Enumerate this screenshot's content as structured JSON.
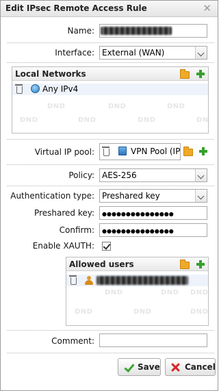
{
  "dialog": {
    "title": "Edit IPsec Remote Access Rule",
    "close_glyph": "✕"
  },
  "form": {
    "name_label": "Name:",
    "interface_label": "Interface:",
    "interface_value": "External (WAN)",
    "local_networks": {
      "header": "Local Networks",
      "items": [
        {
          "icon": "globe-icon",
          "label": "Any IPv4"
        }
      ],
      "watermark": "DND"
    },
    "virtual_ip_pool_label": "Virtual IP pool:",
    "virtual_ip_pool_value": "VPN Pool (IPs",
    "policy_label": "Policy:",
    "policy_value": "AES-256",
    "auth_type_label": "Authentication type:",
    "auth_type_value": "Preshared key",
    "preshared_key_label": "Preshared key:",
    "preshared_key_value": "●●●●●●●●●●●●●●●",
    "confirm_label": "Confirm:",
    "confirm_value": "●●●●●●●●●●●●●●●",
    "enable_xauth_label": "Enable XAUTH:",
    "enable_xauth_checked": true,
    "allowed_users": {
      "header": "Allowed users",
      "watermark": "DND"
    },
    "comment_label": "Comment:",
    "comment_value": ""
  },
  "buttons": {
    "save": "Save",
    "cancel": "Cancel"
  },
  "colors": {
    "add_green": "#36a02c",
    "folder_orange": "#f0a928",
    "cancel_red": "#d4272b"
  }
}
